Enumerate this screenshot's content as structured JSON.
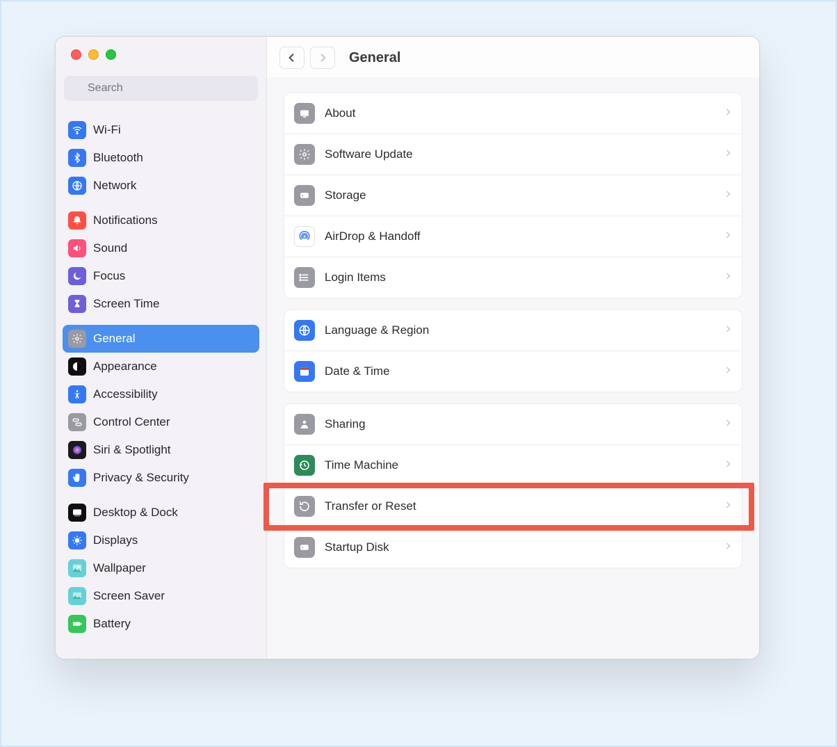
{
  "search": {
    "placeholder": "Search"
  },
  "header": {
    "title": "General"
  },
  "sidebar": {
    "groups": [
      [
        {
          "id": "wifi",
          "label": "Wi-Fi",
          "icon_bg": "#3478f6",
          "icon": "wifi"
        },
        {
          "id": "bluetooth",
          "label": "Bluetooth",
          "icon_bg": "#3478f6",
          "icon": "bluetooth"
        },
        {
          "id": "network",
          "label": "Network",
          "icon_bg": "#3478f6",
          "icon": "globe"
        }
      ],
      [
        {
          "id": "notifications",
          "label": "Notifications",
          "icon_bg": "#ff4f44",
          "icon": "bell"
        },
        {
          "id": "sound",
          "label": "Sound",
          "icon_bg": "#ff4f7a",
          "icon": "sound"
        },
        {
          "id": "focus",
          "label": "Focus",
          "icon_bg": "#6e5edb",
          "icon": "moon"
        },
        {
          "id": "screen-time",
          "label": "Screen Time",
          "icon_bg": "#6e5edb",
          "icon": "hourglass"
        }
      ],
      [
        {
          "id": "general",
          "label": "General",
          "icon_bg": "#9a9aa2",
          "icon": "gear",
          "selected": true
        },
        {
          "id": "appearance",
          "label": "Appearance",
          "icon_bg": "#0f0f10",
          "icon": "appearance"
        },
        {
          "id": "accessibility",
          "label": "Accessibility",
          "icon_bg": "#3478f6",
          "icon": "accessibility"
        },
        {
          "id": "control-center",
          "label": "Control Center",
          "icon_bg": "#9a9aa2",
          "icon": "switches"
        },
        {
          "id": "siri-spotlight",
          "label": "Siri & Spotlight",
          "icon_bg": "#1b1b1d",
          "icon": "siri"
        },
        {
          "id": "privacy-security",
          "label": "Privacy & Security",
          "icon_bg": "#3478f6",
          "icon": "hand"
        }
      ],
      [
        {
          "id": "desktop-dock",
          "label": "Desktop & Dock",
          "icon_bg": "#0f0f10",
          "icon": "dock"
        },
        {
          "id": "displays",
          "label": "Displays",
          "icon_bg": "#3478f6",
          "icon": "brightness"
        },
        {
          "id": "wallpaper",
          "label": "Wallpaper",
          "icon_bg": "#63d2d8",
          "icon": "wallpaper"
        },
        {
          "id": "screen-saver",
          "label": "Screen Saver",
          "icon_bg": "#63d2d8",
          "icon": "screensaver"
        },
        {
          "id": "battery",
          "label": "Battery",
          "icon_bg": "#35c759",
          "icon": "battery"
        }
      ]
    ]
  },
  "main": {
    "groups": [
      [
        {
          "id": "about",
          "label": "About",
          "icon_bg": "#9a9aa2",
          "icon": "about"
        },
        {
          "id": "software-update",
          "label": "Software Update",
          "icon_bg": "#9a9aa2",
          "icon": "gear"
        },
        {
          "id": "storage",
          "label": "Storage",
          "icon_bg": "#9a9aa2",
          "icon": "storage"
        },
        {
          "id": "airdrop-handoff",
          "label": "AirDrop & Handoff",
          "icon_bg": "#ffffff",
          "icon": "airdrop",
          "icon_color": "#3478f6",
          "border": true
        },
        {
          "id": "login-items",
          "label": "Login Items",
          "icon_bg": "#9a9aa2",
          "icon": "list"
        }
      ],
      [
        {
          "id": "language-region",
          "label": "Language & Region",
          "icon_bg": "#3478f6",
          "icon": "globe"
        },
        {
          "id": "date-time",
          "label": "Date & Time",
          "icon_bg": "#3478f6",
          "icon": "calendar"
        }
      ],
      [
        {
          "id": "sharing",
          "label": "Sharing",
          "icon_bg": "#9a9aa2",
          "icon": "sharing"
        },
        {
          "id": "time-machine",
          "label": "Time Machine",
          "icon_bg": "#2f8a5b",
          "icon": "timemachine"
        },
        {
          "id": "transfer-reset",
          "label": "Transfer or Reset",
          "icon_bg": "#9a9aa2",
          "icon": "reset",
          "highlighted": true
        },
        {
          "id": "startup-disk",
          "label": "Startup Disk",
          "icon_bg": "#9a9aa2",
          "icon": "storage"
        }
      ]
    ]
  }
}
